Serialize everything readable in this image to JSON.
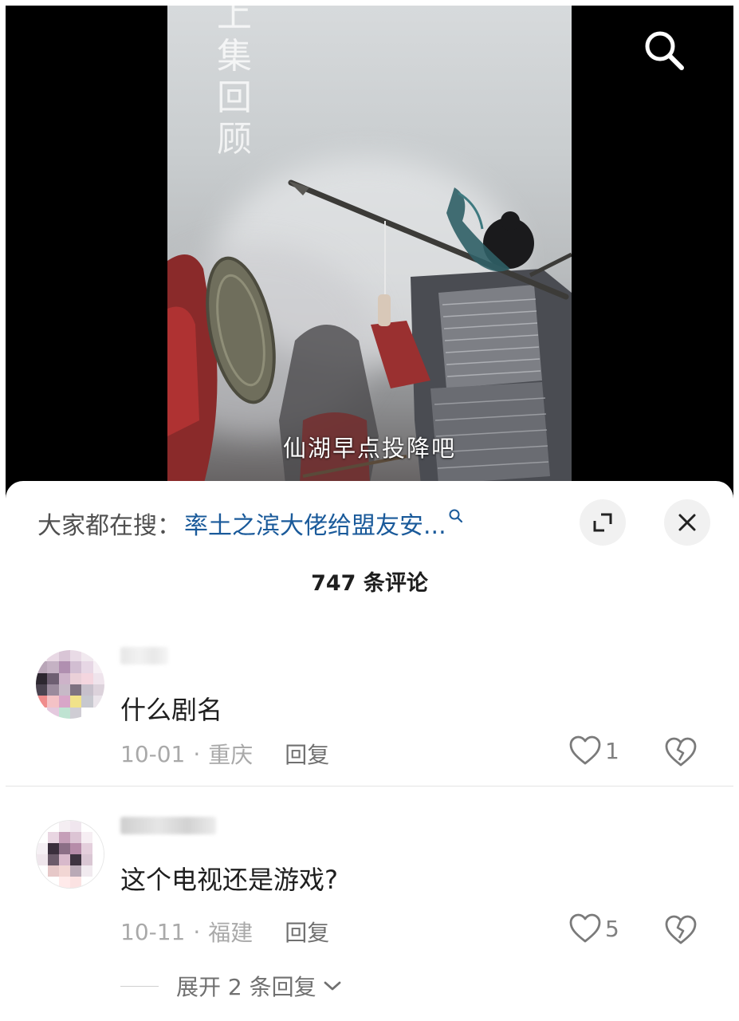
{
  "video": {
    "vertical_title": "上集回顾",
    "subtitle": "仙湖早点投降吧"
  },
  "search_bar": {
    "prefix": "大家都在搜：",
    "term": "率土之滨大佬给盟友安..."
  },
  "comments_header": {
    "count_label": "747 条评论"
  },
  "comments": [
    {
      "text": "什么剧名",
      "date": "10-01",
      "location": "重庆",
      "reply_label": "回复",
      "likes": "1"
    },
    {
      "text": "这个电视还是游戏?",
      "date": "10-11",
      "location": "福建",
      "reply_label": "回复",
      "likes": "5",
      "expand_label": "展开 2 条回复"
    }
  ],
  "icons": {
    "top_search": "search-icon",
    "inline_search": "search-icon",
    "expand": "expand-icon",
    "close": "close-icon",
    "like": "heart-icon",
    "dislike": "broken-heart-icon",
    "chevron": "chevron-down-icon"
  },
  "colors": {
    "search_term": "#1a5a9a",
    "meta_text": "#a9a9a9",
    "round_button_bg": "#f1f1f1"
  },
  "meta_separator": "·"
}
